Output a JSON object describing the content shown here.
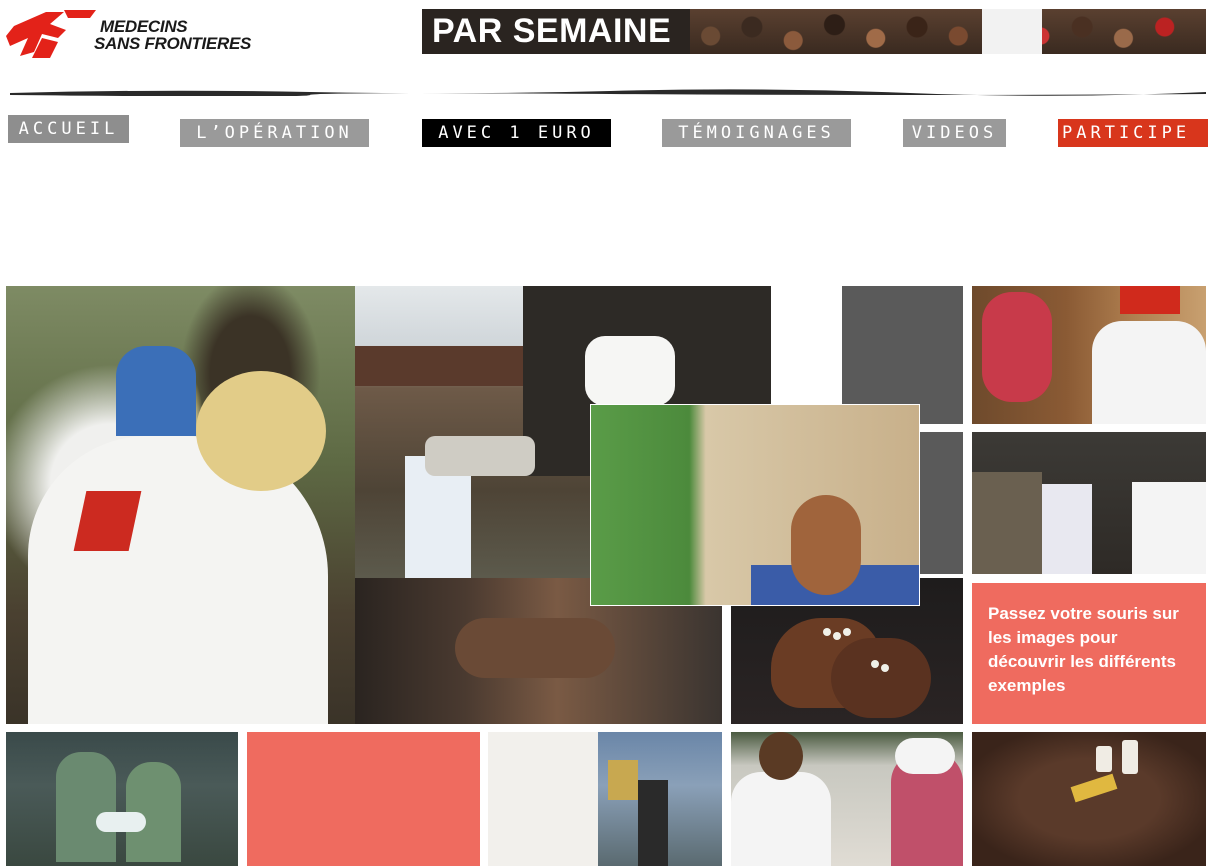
{
  "brand": {
    "logo_line1": "MEDECINS",
    "logo_line2": "SANS FRONTIERES",
    "logo_color": "#e32219"
  },
  "banner": {
    "title": "PAR SEMAINE"
  },
  "nav": {
    "items": [
      {
        "label": "ACCUEIL",
        "style": "gray"
      },
      {
        "label": "L’OPÉRATION",
        "style": "gray"
      },
      {
        "label": "AVEC 1 EURO",
        "style": "active-black"
      },
      {
        "label": "TÉMOIGNAGES",
        "style": "gray"
      },
      {
        "label": "VIDEOS",
        "style": "gray"
      },
      {
        "label": "PARTICIPE",
        "style": "red"
      }
    ]
  },
  "grid": {
    "info_text": "Passez votre souris sur les images pour découvrir les différents exemples",
    "tiles": [
      {
        "id": "nurse",
        "icon": "photo"
      },
      {
        "id": "truck-unloading",
        "icon": "photo"
      },
      {
        "id": "mother-feeding-child",
        "icon": "photo"
      },
      {
        "id": "woman-health-worker",
        "icon": "photo"
      },
      {
        "id": "hiv-group",
        "icon": "photo"
      },
      {
        "id": "hands-child",
        "icon": "photo"
      },
      {
        "id": "pills-in-hands",
        "icon": "photo"
      },
      {
        "id": "surgery",
        "icon": "photo"
      },
      {
        "id": "supply-boxes",
        "icon": "photo"
      },
      {
        "id": "doctor-with-mother",
        "icon": "photo"
      },
      {
        "id": "medicines",
        "icon": "photo"
      }
    ]
  },
  "colors": {
    "accent_red": "#d8361c",
    "salmon": "#ef6b5f",
    "nav_gray": "#9a9a9a",
    "tile_gray": "#5a5a5a"
  }
}
